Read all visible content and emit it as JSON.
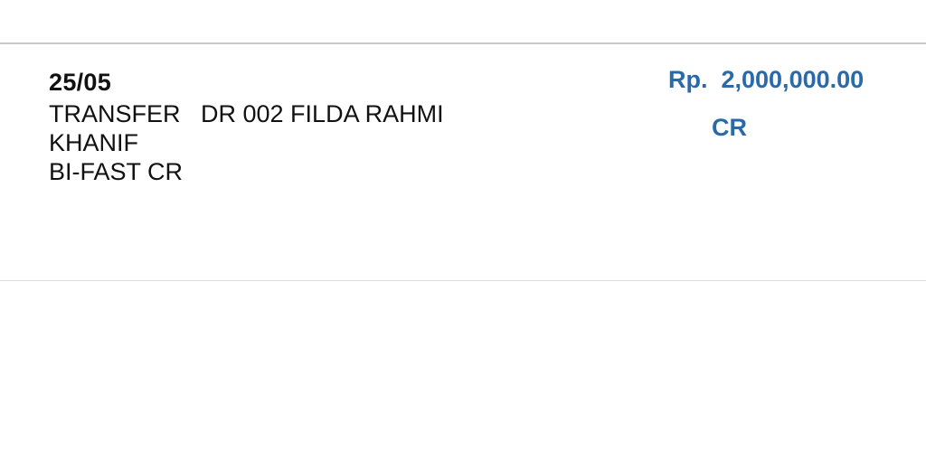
{
  "transaction": {
    "date": "25/05",
    "description_lines": [
      "TRANSFER   DR 002 FILDA RAHMI",
      "KHANIF",
      "BI-FAST CR"
    ],
    "amount": "Rp.  2,000,000.00",
    "type": "CR"
  },
  "colors": {
    "amount_text": "#2a6aa8",
    "body_text": "#111111",
    "divider": "#c9c9c9",
    "background": "#ffffff"
  }
}
